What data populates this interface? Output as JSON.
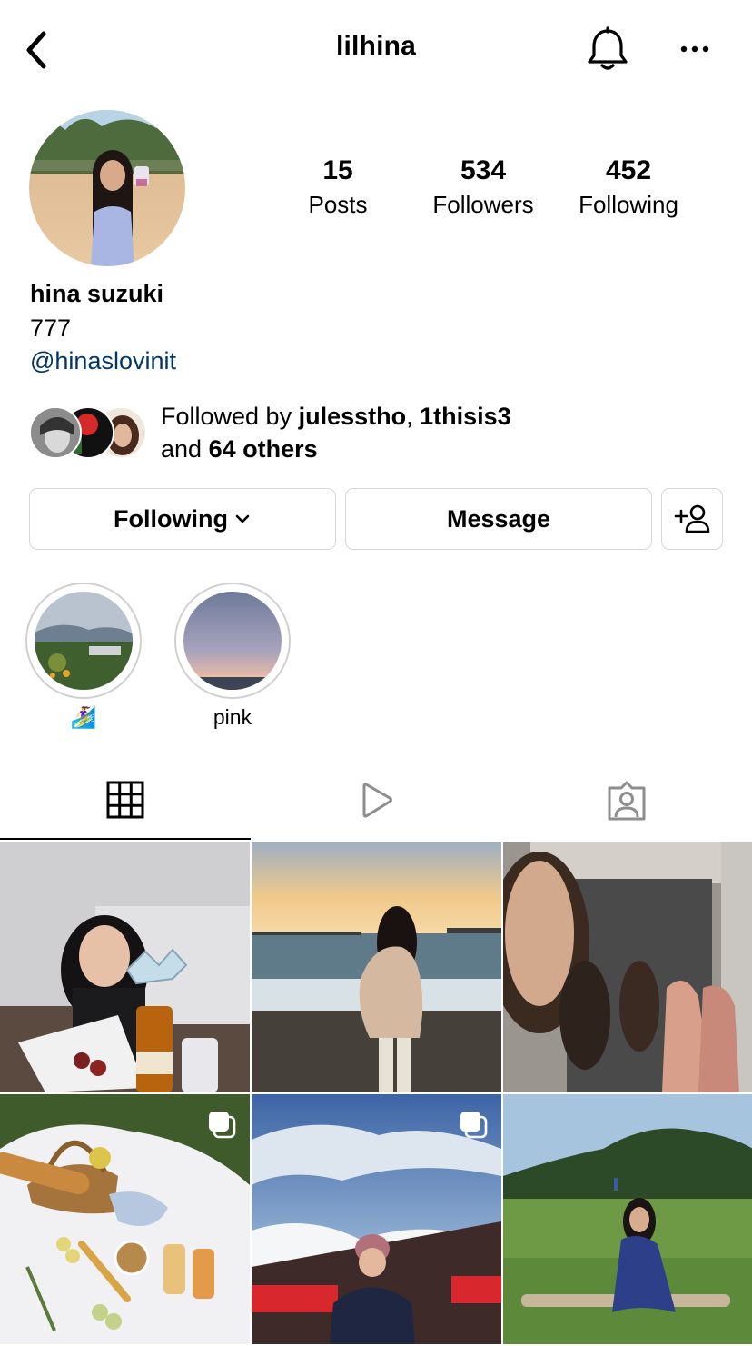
{
  "header": {
    "username": "lilhina",
    "back_icon": "chevron-left-icon",
    "bell_icon": "bell-icon",
    "more_icon": "more-horizontal-icon"
  },
  "profile": {
    "posts_count": "15",
    "posts_label": "Posts",
    "followers_count": "534",
    "followers_label": "Followers",
    "following_count": "452",
    "following_label": "Following",
    "full_name": "hina suzuki",
    "bio": "777",
    "link": "@hinaslovinit"
  },
  "followed_by": {
    "prefix": "Followed by ",
    "user1": "julesstho",
    "separator": ", ",
    "user2": "1thisis3",
    "and_text": "and ",
    "others": "64 others"
  },
  "actions": {
    "following_label": "Following",
    "message_label": "Message",
    "add_user_icon": "add-person-icon"
  },
  "highlights": [
    {
      "label": "🏄‍♀️"
    },
    {
      "label": "pink"
    }
  ],
  "tabs": [
    {
      "name": "posts-grid",
      "icon": "grid-icon",
      "active": true
    },
    {
      "name": "reels",
      "icon": "play-icon",
      "active": false
    },
    {
      "name": "tagged",
      "icon": "tagged-person-icon",
      "active": false
    }
  ],
  "colors": {
    "link": "#00376b",
    "button_border": "#d6d6d6",
    "active_tab_indicator": "#000000"
  }
}
